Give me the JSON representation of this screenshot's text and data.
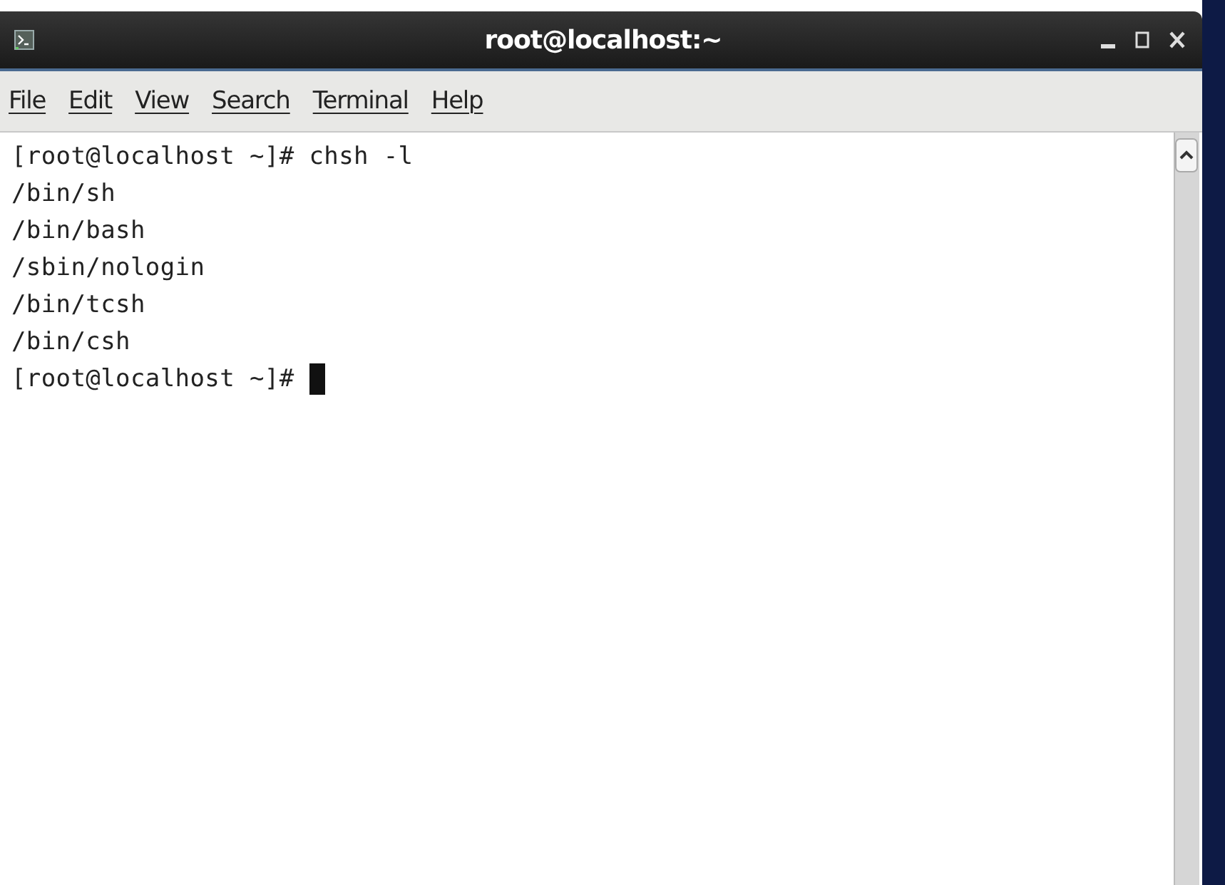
{
  "window": {
    "title": "root@localhost:~"
  },
  "menu": [
    "File",
    "Edit",
    "View",
    "Search",
    "Terminal",
    "Help"
  ],
  "terminal": {
    "lines": [
      "[root@localhost ~]# chsh -l",
      "/bin/sh",
      "/bin/bash",
      "/sbin/nologin",
      "/bin/tcsh",
      "/bin/csh",
      "[root@localhost ~]# "
    ],
    "cursor": true
  }
}
